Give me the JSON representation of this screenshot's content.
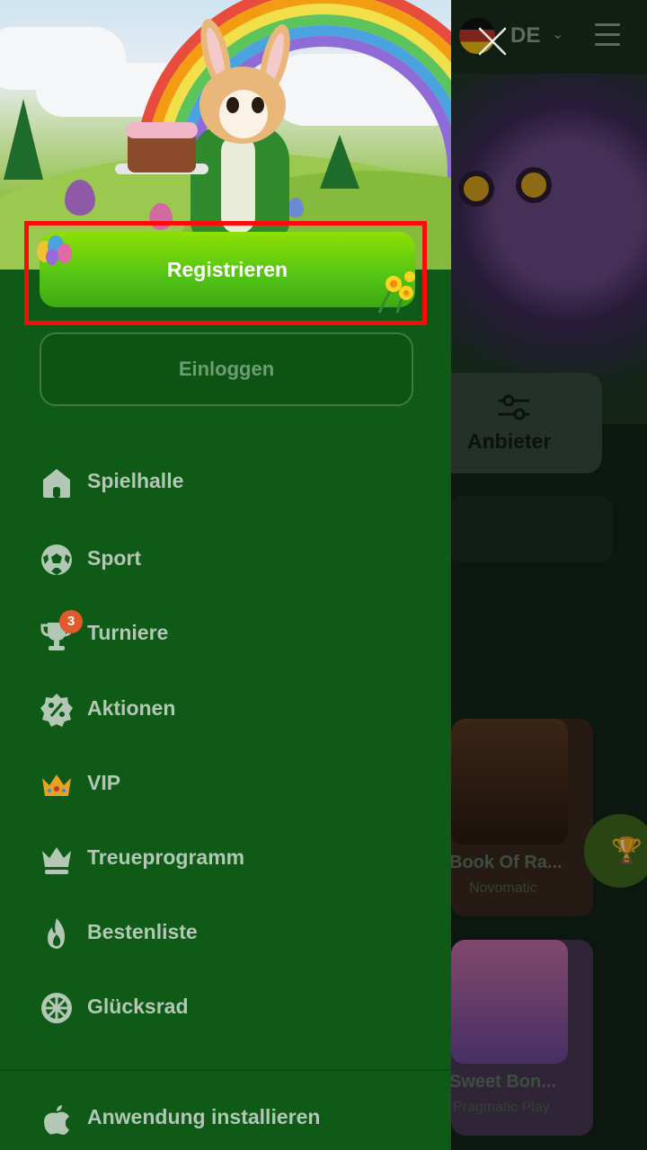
{
  "header": {
    "language": "DE"
  },
  "drawer": {
    "register_label": "Registrieren",
    "login_label": "Einloggen",
    "menu": [
      {
        "label": "Spielhalle",
        "icon": "home-icon"
      },
      {
        "label": "Sport",
        "icon": "soccer-ball-icon"
      },
      {
        "label": "Turniere",
        "icon": "trophy-icon",
        "badge": "3"
      },
      {
        "label": "Aktionen",
        "icon": "percent-badge-icon"
      },
      {
        "label": "VIP",
        "icon": "crown-icon"
      },
      {
        "label": "Treueprogramm",
        "icon": "loyalty-crown-icon"
      },
      {
        "label": "Bestenliste",
        "icon": "flame-icon"
      },
      {
        "label": "Glücksrad",
        "icon": "wheel-icon"
      }
    ],
    "install_label": "Anwendung installieren"
  },
  "background": {
    "filter_label": "Anbieter",
    "games": [
      {
        "title": "Book Of Ra...",
        "provider": "Novomatic"
      },
      {
        "title": "Sweet Bon...",
        "provider": "Pragmatic Play"
      }
    ]
  },
  "colors": {
    "drawer_bg": "#0e5a16",
    "register_green": "#52c316",
    "highlight_red": "#ff0a0a",
    "badge_orange": "#e25a2b"
  }
}
